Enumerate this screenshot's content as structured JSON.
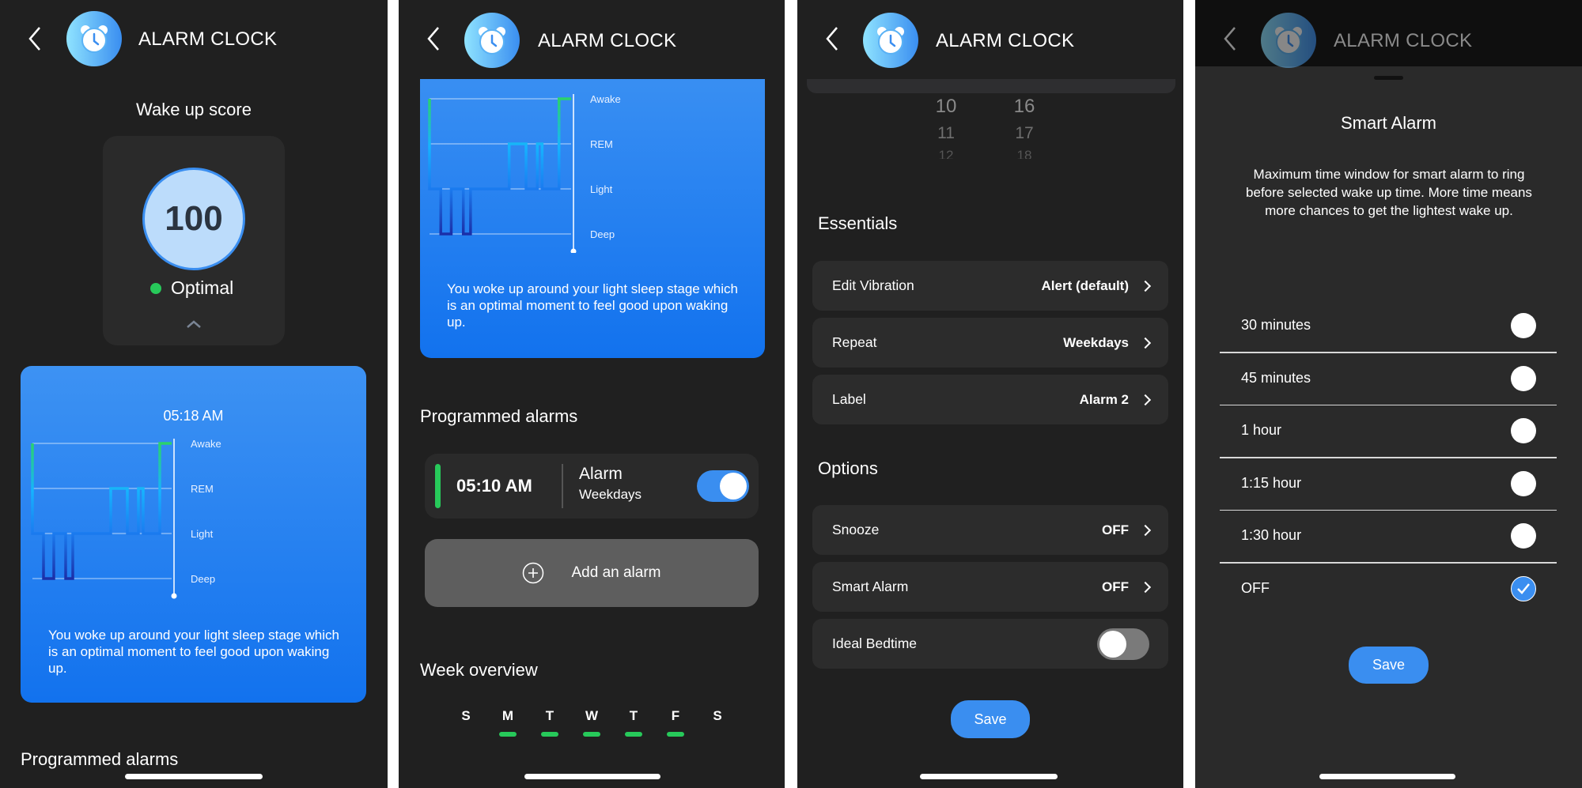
{
  "app": {
    "title": "ALARM CLOCK",
    "icon": "alarm-clock-icon",
    "accent": "#3a8ef0",
    "green": "#27c95a"
  },
  "screen1": {
    "score_title": "Wake up score",
    "score": "100",
    "status": "Optimal",
    "wake_time": "05:18 AM",
    "message": "You woke up around your light sleep stage which is an optimal moment to feel good upon waking up.",
    "section": "Programmed alarms"
  },
  "sleep_chart": {
    "type": "line",
    "stages": [
      "Awake",
      "REM",
      "Light",
      "Deep"
    ],
    "start_stage": "Awake",
    "segments": [
      {
        "stage": "Light",
        "duration": 14
      },
      {
        "stage": "Deep",
        "duration": 13
      },
      {
        "stage": "Light",
        "duration": 15
      },
      {
        "stage": "Deep",
        "duration": 9
      },
      {
        "stage": "Light",
        "duration": 48
      },
      {
        "stage": "REM",
        "duration": 21
      },
      {
        "stage": "Light",
        "duration": 14
      },
      {
        "stage": "REM",
        "duration": 6
      },
      {
        "stage": "Light",
        "duration": 21
      },
      {
        "stage": "Awake",
        "duration": 15
      }
    ]
  },
  "screen2": {
    "message": "You woke up around your light sleep stage which is an optimal moment to feel good upon waking up.",
    "section": "Programmed alarms",
    "alarm": {
      "time": "05:10 AM",
      "label": "Alarm",
      "repeat": "Weekdays",
      "enabled": true
    },
    "add_label": "Add an alarm",
    "week_title": "Week overview",
    "days": [
      {
        "d": "S",
        "on": false
      },
      {
        "d": "M",
        "on": true
      },
      {
        "d": "T",
        "on": true
      },
      {
        "d": "W",
        "on": true
      },
      {
        "d": "T",
        "on": true
      },
      {
        "d": "F",
        "on": true
      },
      {
        "d": "S",
        "on": false
      }
    ]
  },
  "screen3": {
    "picker": {
      "hours": [
        "10",
        "11",
        "12"
      ],
      "minutes": [
        "16",
        "17",
        "18"
      ]
    },
    "essentials_title": "Essentials",
    "essentials": [
      {
        "label": "Edit Vibration",
        "value": "Alert (default)"
      },
      {
        "label": "Repeat",
        "value": "Weekdays"
      },
      {
        "label": "Label",
        "value": "Alarm 2"
      }
    ],
    "options_title": "Options",
    "options": [
      {
        "label": "Snooze",
        "value": "OFF"
      },
      {
        "label": "Smart Alarm",
        "value": "OFF"
      }
    ],
    "ideal_bedtime": {
      "label": "Ideal Bedtime",
      "enabled": false
    },
    "save": "Save"
  },
  "screen4": {
    "title": "Smart Alarm",
    "description": "Maximum time window for smart alarm to ring before selected wake up time. More time means more chances to get the lightest wake up.",
    "options": [
      "30 minutes",
      "45 minutes",
      "1 hour",
      "1:15 hour",
      "1:30 hour",
      "OFF"
    ],
    "selected": "OFF",
    "save": "Save"
  }
}
